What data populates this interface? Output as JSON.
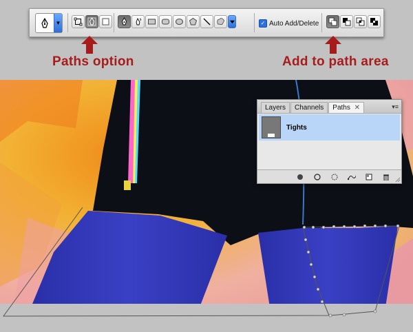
{
  "toolbar": {
    "tool_preset_icon": "pen-tool-icon",
    "mode_buttons": [
      "shape-layers-icon",
      "paths-icon",
      "fill-pixels-icon"
    ],
    "tool_buttons": [
      "pen-tool-icon",
      "freeform-pen-icon",
      "rectangle-icon",
      "rounded-rectangle-icon",
      "ellipse-icon",
      "polygon-icon",
      "line-icon",
      "custom-shape-icon"
    ],
    "auto_add_delete": {
      "label": "Auto Add/Delete",
      "checked": true
    },
    "path_ops": [
      "add-to-path-area-icon",
      "subtract-from-path-area-icon",
      "intersect-path-areas-icon",
      "exclude-overlapping-path-areas-icon"
    ]
  },
  "annotations": {
    "left_label": "Paths option",
    "right_label": "Add to path area",
    "color": "#a81b1b"
  },
  "panel": {
    "tabs": [
      "Layers",
      "Channels",
      "Paths"
    ],
    "active_tab": "Paths",
    "close_glyph": "✕",
    "paths": [
      {
        "name": "Tights",
        "selected": true
      }
    ],
    "footer_icons": [
      "fill-path-icon",
      "stroke-path-icon",
      "load-path-as-selection-icon",
      "make-work-path-icon",
      "new-path-icon",
      "delete-path-icon"
    ]
  },
  "colors": {
    "tights": "#2e33b3",
    "highlight": "#b9d5f7",
    "background": "#c2c2c2"
  }
}
